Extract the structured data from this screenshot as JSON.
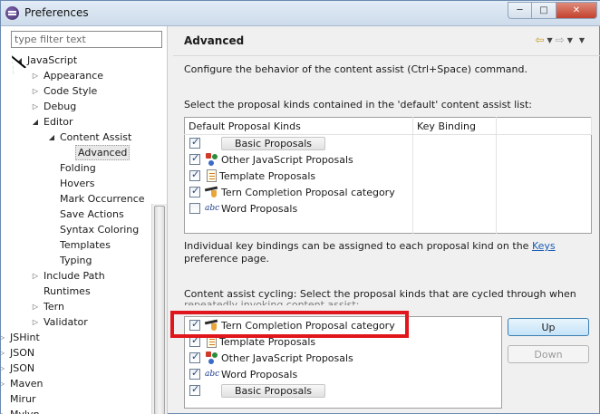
{
  "window": {
    "title": "Preferences"
  },
  "filter": {
    "placeholder": "type filter text"
  },
  "tree": [
    {
      "label": "JavaScript",
      "level": 1,
      "state": "expanded"
    },
    {
      "label": "Appearance",
      "level": 2,
      "state": "collapsed"
    },
    {
      "label": "Code Style",
      "level": 2,
      "state": "collapsed"
    },
    {
      "label": "Debug",
      "level": 2,
      "state": "collapsed"
    },
    {
      "label": "Editor",
      "level": 2,
      "state": "expanded"
    },
    {
      "label": "Content Assist",
      "level": 3,
      "state": "expanded"
    },
    {
      "label": "Advanced",
      "level": 4,
      "state": "leaf",
      "selected": true
    },
    {
      "label": "Folding",
      "level": 3,
      "state": "leaf"
    },
    {
      "label": "Hovers",
      "level": 3,
      "state": "leaf"
    },
    {
      "label": "Mark Occurrence",
      "level": 3,
      "state": "leaf"
    },
    {
      "label": "Save Actions",
      "level": 3,
      "state": "leaf"
    },
    {
      "label": "Syntax Coloring",
      "level": 3,
      "state": "leaf"
    },
    {
      "label": "Templates",
      "level": 3,
      "state": "leaf"
    },
    {
      "label": "Typing",
      "level": 3,
      "state": "leaf"
    },
    {
      "label": "Include Path",
      "level": 2,
      "state": "collapsed"
    },
    {
      "label": "Runtimes",
      "level": 2,
      "state": "leaf"
    },
    {
      "label": "Tern",
      "level": 2,
      "state": "collapsed"
    },
    {
      "label": "Validator",
      "level": 2,
      "state": "collapsed"
    },
    {
      "label": "JSHint",
      "level": 0,
      "state": "collapsed"
    },
    {
      "label": "JSON",
      "level": 0,
      "state": "collapsed"
    },
    {
      "label": "JSON",
      "level": 0,
      "state": "collapsed"
    },
    {
      "label": "Maven",
      "level": 0,
      "state": "collapsed"
    },
    {
      "label": "Mirur",
      "level": 0,
      "state": "leaf"
    },
    {
      "label": "Mylyn",
      "level": 0,
      "state": "collapsed"
    }
  ],
  "page": {
    "title": "Advanced",
    "description": "Configure the behavior of the content assist (Ctrl+Space) command.",
    "default_list_label": "Select the proposal kinds contained in the 'default' content assist list:",
    "table1": {
      "headers": [
        "Default Proposal Kinds",
        "Key Binding"
      ],
      "rows": [
        {
          "checked": true,
          "icon": "blank",
          "label": "Basic Proposals",
          "pill": true
        },
        {
          "checked": true,
          "icon": "javascript-proposals-icon",
          "label": "Other JavaScript Proposals"
        },
        {
          "checked": true,
          "icon": "template-icon",
          "label": "Template Proposals"
        },
        {
          "checked": true,
          "icon": "tern-icon",
          "label": "Tern Completion Proposal category"
        },
        {
          "checked": false,
          "icon": "word-icon",
          "label": "Word Proposals"
        }
      ]
    },
    "keybind_text_1": "Individual key bindings can be assigned to each proposal kind on the ",
    "keybind_link": "Keys",
    "keybind_text_2": "preference page.",
    "cycling_label": "Content assist cycling: Select the proposal kinds that are cycled through when",
    "cycling_label_2": "repeatedly invoking content assist:",
    "table2": {
      "rows": [
        {
          "checked": true,
          "icon": "tern-icon",
          "label": "Tern Completion Proposal category"
        },
        {
          "checked": true,
          "icon": "template-icon",
          "label": "Template Proposals"
        },
        {
          "checked": true,
          "icon": "javascript-proposals-icon",
          "label": "Other JavaScript Proposals"
        },
        {
          "checked": true,
          "icon": "word-icon",
          "label": "Word Proposals"
        },
        {
          "checked": true,
          "icon": "blank",
          "label": "Basic Proposals",
          "pill": true
        }
      ]
    },
    "buttons": {
      "up": "Up",
      "down": "Down"
    },
    "word_icon_text": "abc"
  },
  "colors": {
    "highlight": "#e0161c",
    "link": "#1a5bb4"
  }
}
